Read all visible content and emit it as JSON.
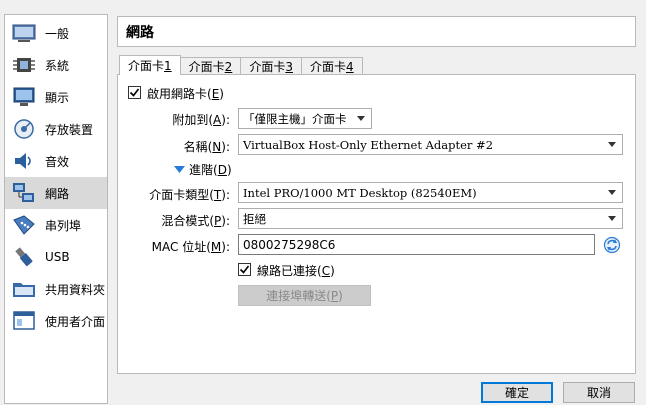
{
  "sidebar": {
    "items": [
      {
        "label": "一般",
        "icon": "general-icon"
      },
      {
        "label": "系統",
        "icon": "chip-icon"
      },
      {
        "label": "顯示",
        "icon": "monitor-icon"
      },
      {
        "label": "存放裝置",
        "icon": "storage-icon"
      },
      {
        "label": "音效",
        "icon": "speaker-icon"
      },
      {
        "label": "網路",
        "icon": "network-icon",
        "active": true
      },
      {
        "label": "串列埠",
        "icon": "serial-port-icon"
      },
      {
        "label": "USB",
        "icon": "usb-icon"
      },
      {
        "label": "共用資料夾",
        "icon": "folder-icon"
      },
      {
        "label": "使用者介面",
        "icon": "ui-icon"
      }
    ]
  },
  "header": {
    "title": "網路"
  },
  "tabs": [
    {
      "prefix": "介面卡 ",
      "key": "1",
      "active": true
    },
    {
      "prefix": "介面卡 ",
      "key": "2"
    },
    {
      "prefix": "介面卡 ",
      "key": "3"
    },
    {
      "prefix": "介面卡 ",
      "key": "4"
    }
  ],
  "adapter": {
    "enable_label": "啟用網路卡(",
    "enable_key": "E",
    "enable_suffix": ")",
    "attached_label": "附加到(",
    "attached_key": "A",
    "attached_value": "「僅限主機」介面卡",
    "name_label": "名稱(",
    "name_key": "N",
    "name_value": "VirtualBox Host-Only Ethernet Adapter #2",
    "advanced_label": "進階(",
    "advanced_key": "D",
    "type_label": "介面卡類型(",
    "type_key": "T",
    "type_value": "Intel PRO/1000 MT Desktop (82540EM)",
    "promisc_label": "混合模式(",
    "promisc_key": "P",
    "promisc_value": "拒絕",
    "mac_label": "MAC 位址(",
    "mac_key": "M",
    "mac_value": "0800275298C6",
    "cable_label": "線路已連接(",
    "cable_key": "C",
    "port_fwd_label": "連接埠轉送(",
    "port_fwd_key": "P"
  },
  "footer": {
    "ok": "確定",
    "cancel": "取消"
  },
  "colors": {
    "accent": "#0078d7",
    "refresh": "#2a7bd5"
  }
}
